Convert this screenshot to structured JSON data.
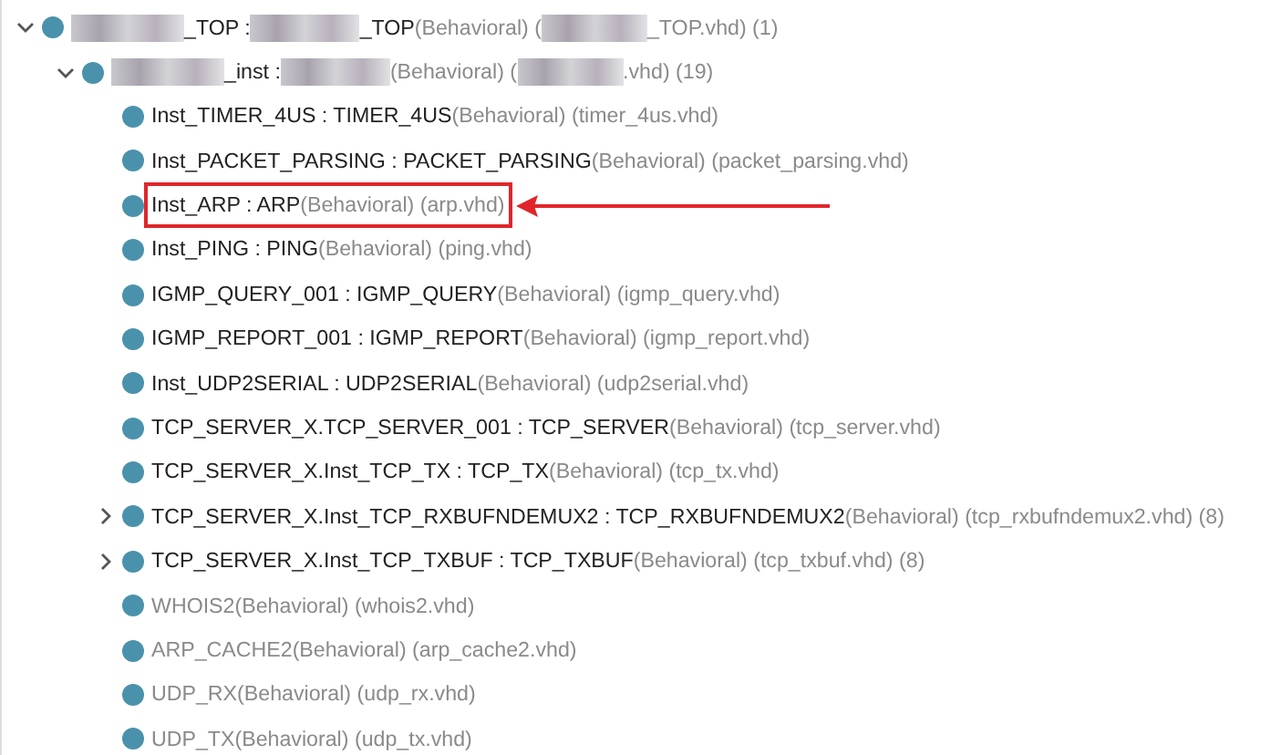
{
  "tree": [
    {
      "expanded": true,
      "segments": [
        {
          "kind": "redacted"
        },
        {
          "kind": "name",
          "text": "_TOP : "
        },
        {
          "kind": "redacted"
        },
        {
          "kind": "name",
          "text": "_TOP"
        },
        {
          "kind": "detail",
          "text": "(Behavioral) ("
        },
        {
          "kind": "redacted"
        },
        {
          "kind": "detail",
          "text": "_TOP.vhd) (1)"
        }
      ],
      "children": [
        {
          "expanded": true,
          "segments": [
            {
              "kind": "redacted"
            },
            {
              "kind": "name",
              "text": "_inst : "
            },
            {
              "kind": "redacted"
            },
            {
              "kind": "detail",
              "text": "(Behavioral) ("
            },
            {
              "kind": "redacted"
            },
            {
              "kind": "detail",
              "text": ".vhd) (19)"
            }
          ],
          "children": [
            {
              "segments": [
                {
                  "kind": "name",
                  "text": "Inst_TIMER_4US : TIMER_4US"
                },
                {
                  "kind": "detail",
                  "text": "(Behavioral) (timer_4us.vhd)"
                }
              ]
            },
            {
              "segments": [
                {
                  "kind": "name",
                  "text": "Inst_PACKET_PARSING : PACKET_PARSING"
                },
                {
                  "kind": "detail",
                  "text": "(Behavioral) (packet_parsing.vhd)"
                }
              ]
            },
            {
              "boxed": true,
              "segments": [
                {
                  "kind": "name",
                  "text": "Inst_ARP : ARP"
                },
                {
                  "kind": "detail",
                  "text": "(Behavioral) (arp.vhd)"
                }
              ]
            },
            {
              "segments": [
                {
                  "kind": "name",
                  "text": "Inst_PING : PING"
                },
                {
                  "kind": "detail",
                  "text": "(Behavioral) (ping.vhd)"
                }
              ]
            },
            {
              "segments": [
                {
                  "kind": "name",
                  "text": "IGMP_QUERY_001 : IGMP_QUERY"
                },
                {
                  "kind": "detail",
                  "text": "(Behavioral) (igmp_query.vhd)"
                }
              ]
            },
            {
              "segments": [
                {
                  "kind": "name",
                  "text": "IGMP_REPORT_001 : IGMP_REPORT"
                },
                {
                  "kind": "detail",
                  "text": "(Behavioral) (igmp_report.vhd)"
                }
              ]
            },
            {
              "segments": [
                {
                  "kind": "name",
                  "text": "Inst_UDP2SERIAL : UDP2SERIAL"
                },
                {
                  "kind": "detail",
                  "text": "(Behavioral) (udp2serial.vhd)"
                }
              ]
            },
            {
              "segments": [
                {
                  "kind": "name",
                  "text": "TCP_SERVER_X.TCP_SERVER_001 : TCP_SERVER"
                },
                {
                  "kind": "detail",
                  "text": "(Behavioral) (tcp_server.vhd)"
                }
              ]
            },
            {
              "segments": [
                {
                  "kind": "name",
                  "text": "TCP_SERVER_X.Inst_TCP_TX : TCP_TX"
                },
                {
                  "kind": "detail",
                  "text": "(Behavioral) (tcp_tx.vhd)"
                }
              ]
            },
            {
              "expanded": false,
              "segments": [
                {
                  "kind": "name",
                  "text": "TCP_SERVER_X.Inst_TCP_RXBUFNDEMUX2 : TCP_RXBUFNDEMUX2"
                },
                {
                  "kind": "detail",
                  "text": "(Behavioral) (tcp_rxbufndemux2.vhd) (8)"
                }
              ]
            },
            {
              "expanded": false,
              "segments": [
                {
                  "kind": "name",
                  "text": "TCP_SERVER_X.Inst_TCP_TXBUF : TCP_TXBUF"
                },
                {
                  "kind": "detail",
                  "text": "(Behavioral) (tcp_txbuf.vhd) (8)"
                }
              ]
            },
            {
              "segments": [
                {
                  "kind": "detail",
                  "text": "WHOIS2(Behavioral) (whois2.vhd)"
                }
              ]
            },
            {
              "segments": [
                {
                  "kind": "detail",
                  "text": "ARP_CACHE2(Behavioral) (arp_cache2.vhd)"
                }
              ]
            },
            {
              "segments": [
                {
                  "kind": "detail",
                  "text": "UDP_RX(Behavioral) (udp_rx.vhd)"
                }
              ]
            },
            {
              "segments": [
                {
                  "kind": "detail",
                  "text": "UDP_TX(Behavioral) (udp_tx.vhd)"
                }
              ]
            }
          ]
        }
      ]
    }
  ]
}
